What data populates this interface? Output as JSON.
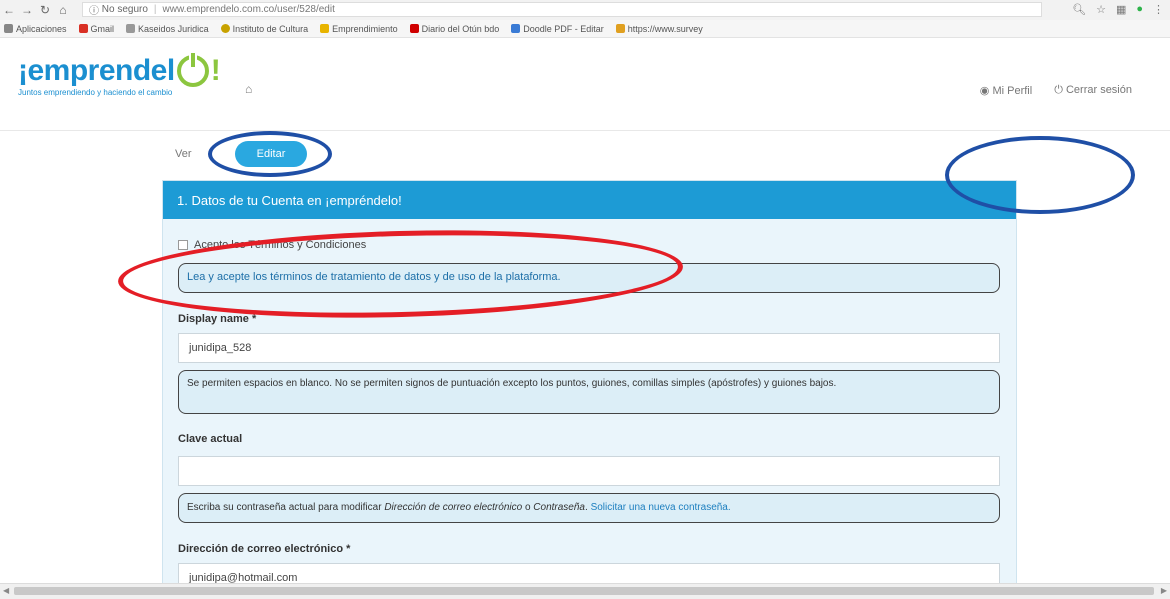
{
  "browser": {
    "security_label": "No seguro",
    "url": "www.emprendelo.com.co/user/528/edit",
    "bookmarks": [
      {
        "label": "Aplicaciones",
        "color": "#888888"
      },
      {
        "label": "Gmail",
        "color": "#d93025"
      },
      {
        "label": "Kaseidos Juridica",
        "color": "#999999"
      },
      {
        "label": "Instituto de Cultura",
        "color": "#c8a200"
      },
      {
        "label": "Emprendimiento",
        "color": "#e8b400"
      },
      {
        "label": "Diario del Otún bdo",
        "color": "#d00000"
      },
      {
        "label": "Doodle PDF - Editar",
        "color": "#3a7bd5"
      },
      {
        "label": "https://www.survey",
        "color": "#e0a020"
      }
    ]
  },
  "site": {
    "logo_text": "¡emprendel",
    "logo_suffix": "!",
    "tagline": "Juntos emprendiendo y haciendo el cambio",
    "profile_link": "Mi Perfil",
    "logout_link": "Cerrar sesión"
  },
  "tabs": {
    "ver": "Ver",
    "editar": "Editar"
  },
  "panel": {
    "title": "1. Datos de tu Cuenta en ¡empréndelo!",
    "terms_label": "Acepto los Términos y Condiciones",
    "terms_help": "Lea y acepte los términos de tratamiento de datos y de uso de la plataforma.",
    "display_name_label": "Display name *",
    "display_name_value": "junidipa_528",
    "display_name_help": "Se permiten espacios en blanco. No se permiten signos de puntuación excepto los puntos, guiones, comillas simples (apóstrofes) y guiones bajos.",
    "clave_label": "Clave actual",
    "clave_value": "",
    "clave_help_prefix": "Escriba su contraseña actual para modificar ",
    "clave_help_em1": "Dirección de correo electrónico",
    "clave_help_mid": " o ",
    "clave_help_em2": "Contraseña",
    "clave_help_suffix": ". ",
    "clave_help_link": "Solicitar una nueva contraseña.",
    "email_label": "Dirección de correo electrónico *",
    "email_value": "junidipa@hotmail.com"
  },
  "colors": {
    "accent": "#1d9bd5",
    "annotation_blue": "#1f4fa6",
    "annotation_red": "#e41e26",
    "logo_green": "#8cc63f"
  }
}
